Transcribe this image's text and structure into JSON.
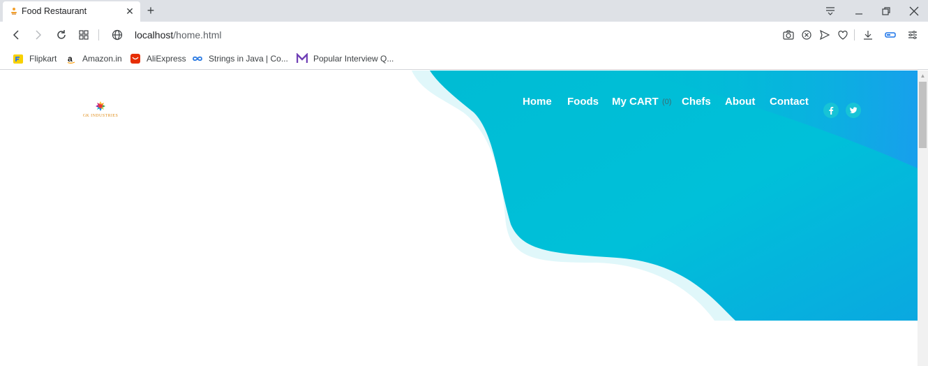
{
  "browser": {
    "tab": {
      "title": "Food Restaurant",
      "close_icon": "close-icon"
    },
    "new_tab_icon": "plus-icon",
    "window_controls": [
      "tab-search-icon",
      "minimize-icon",
      "restore-icon",
      "close-window-icon"
    ],
    "address": {
      "host": "localhost",
      "path": "/home.html"
    },
    "toolbar_icons_left": [
      "back-icon",
      "forward-icon",
      "reload-icon",
      "apps-grid-icon",
      "globe-icon"
    ],
    "toolbar_icons_right": [
      "camera-icon",
      "block-icon",
      "send-icon",
      "heart-icon",
      "download-icon",
      "sidebar-toggle-icon",
      "settings-icon"
    ],
    "bookmarks": [
      {
        "label": "Flipkart",
        "icon": "flipkart-icon"
      },
      {
        "label": "Amazon.in",
        "icon": "amazon-icon"
      },
      {
        "label": "AliExpress",
        "icon": "aliexpress-icon"
      },
      {
        "label": "Strings in Java | Co...",
        "icon": "infinity-icon"
      },
      {
        "label": "Popular Interview Q...",
        "icon": "m-logo-icon"
      }
    ]
  },
  "page": {
    "logo_text": "GK INDUSTRIES",
    "nav": {
      "home": "Home",
      "foods": "Foods",
      "cart": "My CART",
      "cart_count": "(0)",
      "chefs": "Chefs",
      "about": "About",
      "contact": "Contact"
    },
    "social": [
      {
        "icon": "facebook-icon",
        "glyph": "f"
      },
      {
        "icon": "twitter-icon",
        "glyph": "t"
      }
    ],
    "colors": {
      "hero_primary": "#00bcd4",
      "hero_secondary": "#1aa3ea",
      "wave_light": "#e0f7fa",
      "accent": "#17c3d6"
    }
  }
}
